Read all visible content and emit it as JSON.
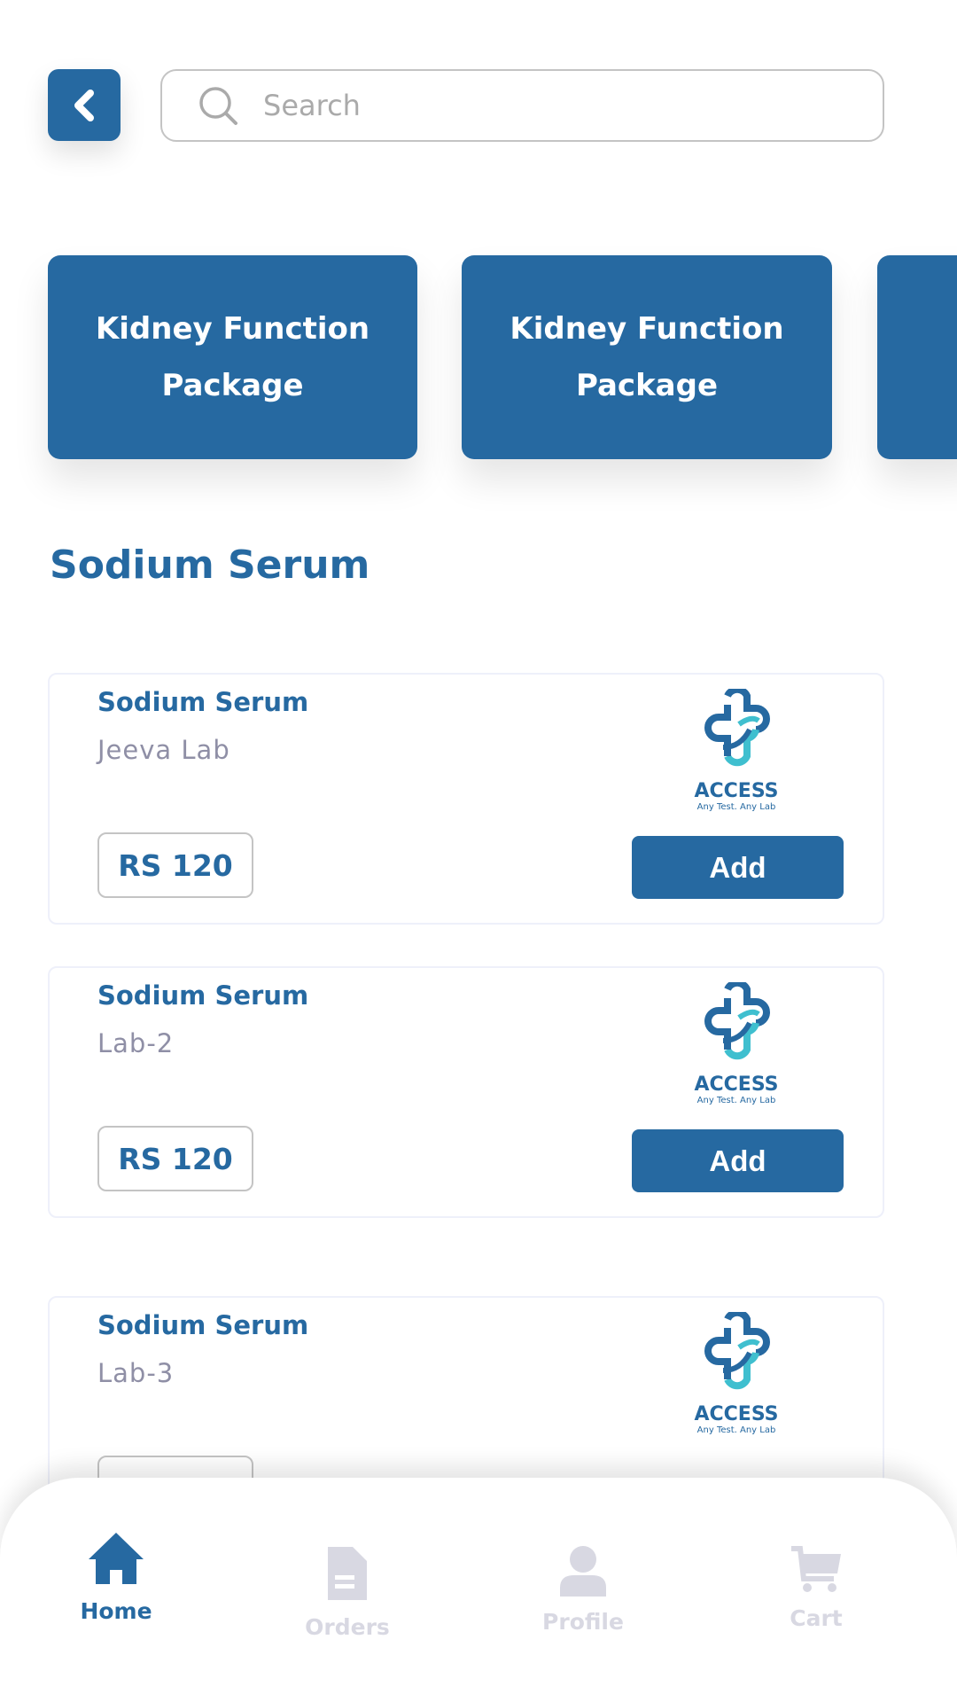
{
  "search": {
    "placeholder": "Search"
  },
  "packages": [
    {
      "label": "Kidney Function Package"
    },
    {
      "label": "Kidney Function Package"
    },
    {
      "label": ""
    }
  ],
  "section_title": "Sodium Serum",
  "logo": {
    "brand": "ACCESS",
    "tagline": "Any Test. Any Lab"
  },
  "results": [
    {
      "title": "Sodium Serum",
      "lab": "Jeeva Lab",
      "price": "RS 120",
      "button": "Add"
    },
    {
      "title": "Sodium Serum",
      "lab": "Lab-2",
      "price": "RS 120",
      "button": "Add"
    },
    {
      "title": "Sodium Serum",
      "lab": "Lab-3",
      "price": "",
      "button": ""
    }
  ],
  "nav": [
    {
      "label": "Home",
      "icon": "home-icon",
      "active": true
    },
    {
      "label": "Orders",
      "icon": "document-icon"
    },
    {
      "label": "Profile",
      "icon": "user-icon"
    },
    {
      "label": "Cart",
      "icon": "cart-icon"
    }
  ],
  "colors": {
    "primary": "#2669a1",
    "inactive": "#d8d8e2",
    "secondary_text": "#8f8fa6",
    "logo_teal": "#3fbfcf"
  }
}
